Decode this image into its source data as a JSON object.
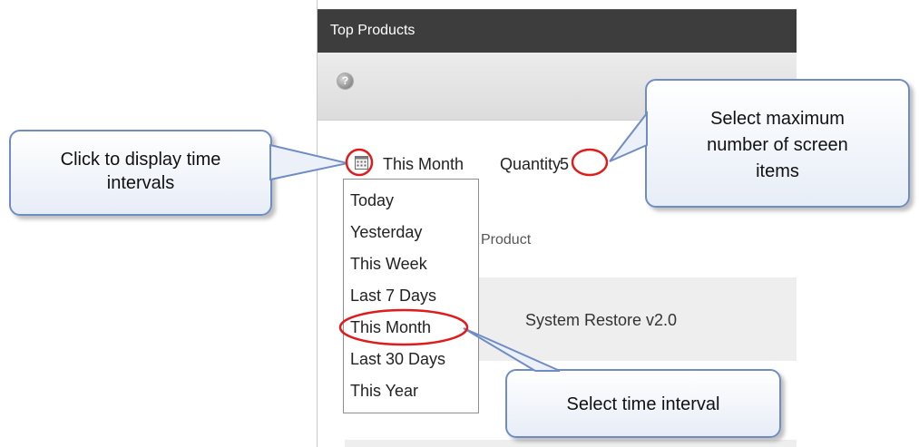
{
  "widget": {
    "title": "Top Products",
    "help_icon": "help-icon",
    "help_glyph": "?",
    "interval_icon": "calendar-icon",
    "interval_label": "This Month",
    "quantity_label": "Quantity",
    "quantity_value": "5",
    "table_header": "Product",
    "rows": [
      {
        "product": "System Restore v2.0"
      }
    ]
  },
  "dropdown": {
    "items": [
      "Today",
      "Yesterday",
      "This Week",
      "Last 7 Days",
      "This Month",
      "Last 30 Days",
      "This Year"
    ],
    "highlighted": "This Month"
  },
  "callouts": {
    "left_line1": "Click to display time",
    "left_line2": "intervals",
    "right_line1": "Select maximum",
    "right_line2": "number of screen",
    "right_line3": "items",
    "bottom": "Select time interval"
  },
  "colors": {
    "header_bg": "#3d3d3d",
    "callout_border": "#6f8dc4",
    "highlight_ring": "#e01b1b"
  }
}
